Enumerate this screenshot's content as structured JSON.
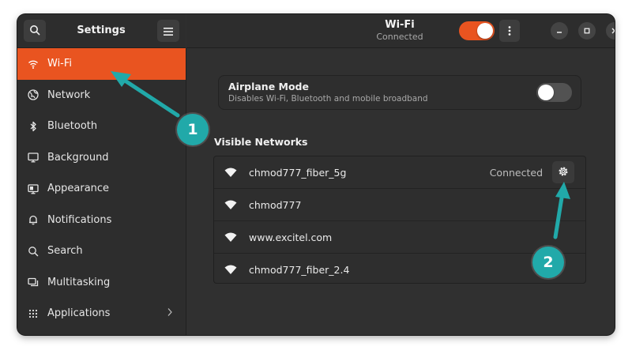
{
  "header": {
    "sidebar_title": "Settings",
    "window_title": "Wi-Fi",
    "window_subtitle": "Connected",
    "wifi_toggle_on": true,
    "accent_color": "#e95420"
  },
  "sidebar": {
    "items": [
      {
        "label": "Wi-Fi",
        "icon": "wifi-icon",
        "active": true
      },
      {
        "label": "Network",
        "icon": "globe-icon"
      },
      {
        "label": "Bluetooth",
        "icon": "bluetooth-icon"
      },
      {
        "label": "Background",
        "icon": "monitor-icon"
      },
      {
        "label": "Appearance",
        "icon": "appearance-icon"
      },
      {
        "label": "Notifications",
        "icon": "bell-icon"
      },
      {
        "label": "Search",
        "icon": "search-icon"
      },
      {
        "label": "Multitasking",
        "icon": "multitasking-icon"
      },
      {
        "label": "Applications",
        "icon": "grid-icon",
        "has_chevron": true
      }
    ]
  },
  "airplane": {
    "title": "Airplane Mode",
    "subtitle": "Disables Wi-Fi, Bluetooth and mobile broadband",
    "enabled": false
  },
  "networks": {
    "section_title": "Visible Networks",
    "items": [
      {
        "name": "chmod777_fiber_5g",
        "status": "Connected"
      },
      {
        "name": "chmod777"
      },
      {
        "name": "www.excitel.com"
      },
      {
        "name": "chmod777_fiber_2.4"
      }
    ]
  },
  "annotations": [
    {
      "number": "1",
      "color": "#21a9a9"
    },
    {
      "number": "2",
      "color": "#21a9a9"
    }
  ]
}
